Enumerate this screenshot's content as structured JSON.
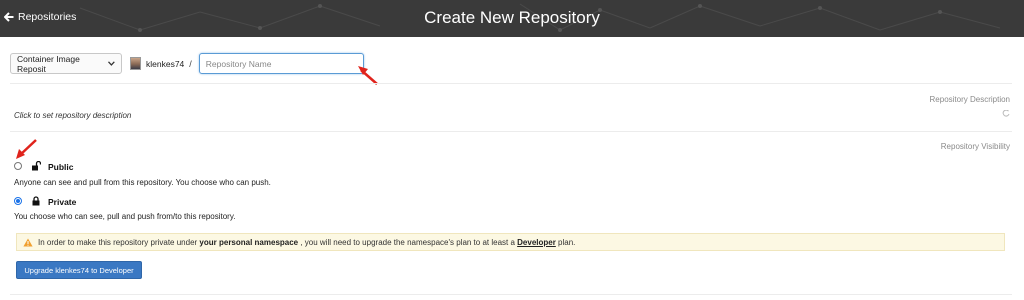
{
  "header": {
    "back_label": "Repositories",
    "title": "Create New Repository"
  },
  "form": {
    "repo_type_value": "Container Image Reposit",
    "namespace": "klenkes74",
    "separator": "/",
    "name_placeholder": "Repository Name"
  },
  "description": {
    "section_label": "Repository Description",
    "placeholder_text": "Click to set repository description"
  },
  "visibility": {
    "section_label": "Repository Visibility",
    "public": {
      "label": "Public",
      "description": "Anyone can see and pull from this repository. You choose who can push.",
      "selected": false
    },
    "private": {
      "label": "Private",
      "description": "You choose who can see, pull and push from/to this repository.",
      "selected": true
    }
  },
  "warning": {
    "text_before": "In order to make this repository private under ",
    "namespace_emph": "your personal namespace",
    "text_middle": " , you will need to upgrade the namespace's plan to at least a ",
    "plan_emph": "Developer",
    "text_after": " plan."
  },
  "upgrade_button": "Upgrade klenkes74 to Developer",
  "colors": {
    "header_bg": "#3a3a3a",
    "accent_blue": "#3a78c3",
    "radio_blue": "#1b73e8",
    "warning_bg": "#fcf8e3",
    "arrow_red": "#e0231c"
  }
}
